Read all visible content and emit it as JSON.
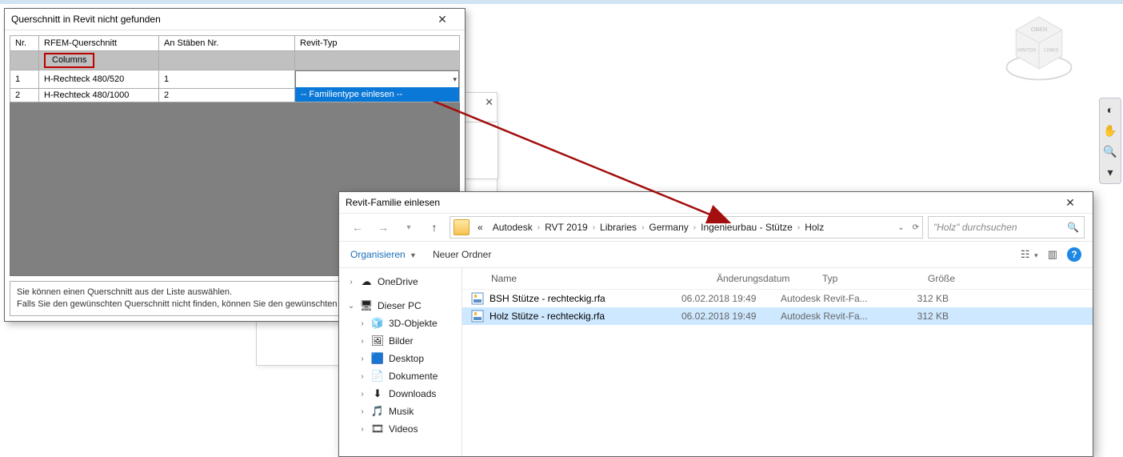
{
  "dlg1": {
    "title": "Querschnitt in Revit nicht gefunden",
    "cols": {
      "nr": "Nr.",
      "rfem": "RFEM-Querschnitt",
      "stab": "An Stäben Nr.",
      "revit": "Revit-Typ"
    },
    "group": "Columns",
    "rows": [
      {
        "nr": "1",
        "rfem": "H-Rechteck 480/520",
        "stab": "1"
      },
      {
        "nr": "2",
        "rfem": "H-Rechteck 480/1000",
        "stab": "2"
      }
    ],
    "dropdown_item": "-- Familientype einlesen --",
    "hint_l1": "Sie können einen Querschnitt aus der Liste auswählen.",
    "hint_l2": "Falls Sie den gewünschten Querschnitt nicht finden, können Sie den gewünschten Typ einlesen."
  },
  "dlg2": {
    "title": "Revit-Familie einlesen",
    "breadcrumb": {
      "pre": "«",
      "parts": [
        "Autodesk",
        "RVT 2019",
        "Libraries",
        "Germany",
        "Ingenieurbau - Stütze",
        "Holz"
      ]
    },
    "search_placeholder": "\"Holz\" durchsuchen",
    "organise": "Organisieren",
    "newfolder": "Neuer Ordner",
    "tree": [
      {
        "icon": "cloud",
        "label": "OneDrive",
        "expander": ">"
      },
      {
        "icon": "pc",
        "label": "Dieser PC",
        "expander": "v"
      },
      {
        "icon": "cube",
        "label": "3D-Objekte",
        "indent": 1,
        "expander": ">"
      },
      {
        "icon": "pic",
        "label": "Bilder",
        "indent": 1,
        "expander": ">"
      },
      {
        "icon": "desk",
        "label": "Desktop",
        "indent": 1,
        "expander": ">"
      },
      {
        "icon": "doc",
        "label": "Dokumente",
        "indent": 1,
        "expander": ">"
      },
      {
        "icon": "down",
        "label": "Downloads",
        "indent": 1,
        "expander": ">"
      },
      {
        "icon": "music",
        "label": "Musik",
        "indent": 1,
        "expander": ">"
      },
      {
        "icon": "video",
        "label": "Videos",
        "indent": 1,
        "expander": ">"
      }
    ],
    "cols": {
      "name": "Name",
      "date": "Änderungsdatum",
      "type": "Typ",
      "size": "Größe"
    },
    "files": [
      {
        "name": "BSH Stütze - rechteckig.rfa",
        "date": "06.02.2018 19:49",
        "type": "Autodesk Revit-Fa...",
        "size": "312 KB",
        "sel": false
      },
      {
        "name": "Holz Stütze - rechteckig.rfa",
        "date": "06.02.2018 19:49",
        "type": "Autodesk Revit-Fa...",
        "size": "312 KB",
        "sel": true
      }
    ]
  },
  "viewcube": {
    "top": "OBEN",
    "left": "HINTEN",
    "right": "LINKS"
  }
}
